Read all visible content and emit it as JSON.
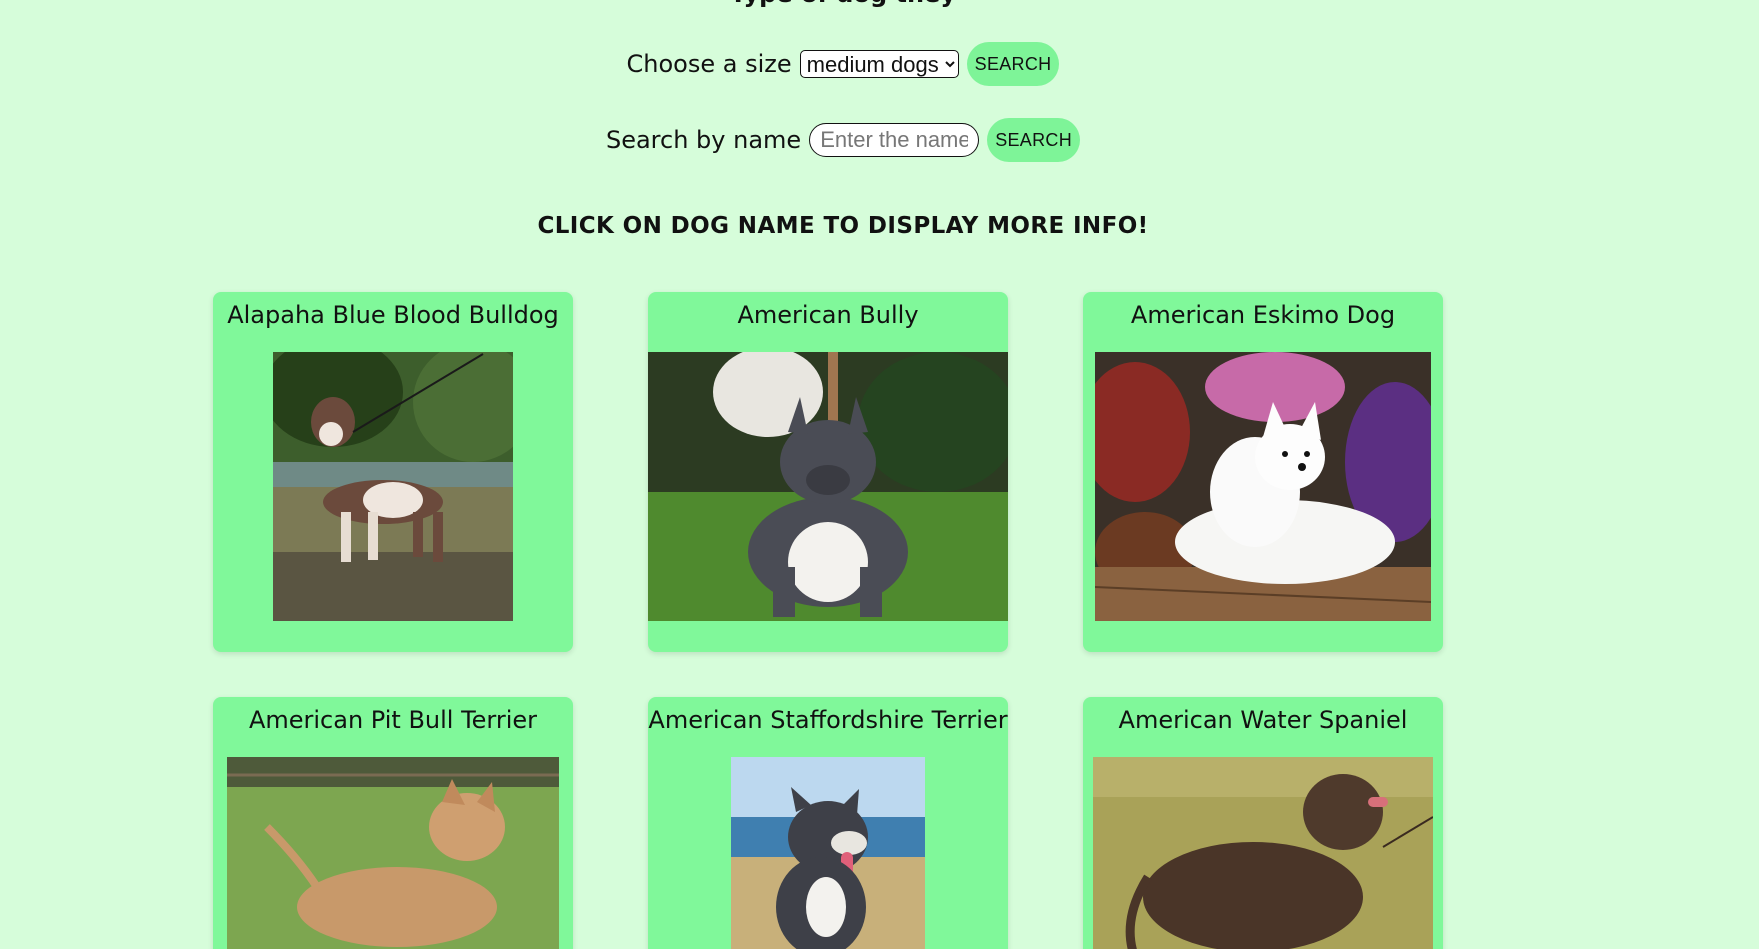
{
  "heading": "Type of dog they",
  "size_filter": {
    "label": "Choose a size",
    "selected": "medium dogs",
    "button": "SEARCH"
  },
  "name_filter": {
    "label": "Search by name",
    "placeholder": "Enter the name",
    "value": "",
    "button": "SEARCH"
  },
  "hint": "CLICK ON DOG NAME TO DISPLAY MORE INFO!",
  "dogs": [
    {
      "name": "Alapaha Blue Blood Bulldog"
    },
    {
      "name": "American Bully"
    },
    {
      "name": "American Eskimo Dog"
    },
    {
      "name": "American Pit Bull Terrier"
    },
    {
      "name": "American Staffordshire Terrier"
    },
    {
      "name": "American Water Spaniel"
    }
  ],
  "colors": {
    "background": "#d6fdda",
    "card": "#80f89a",
    "button": "#7ef498"
  }
}
